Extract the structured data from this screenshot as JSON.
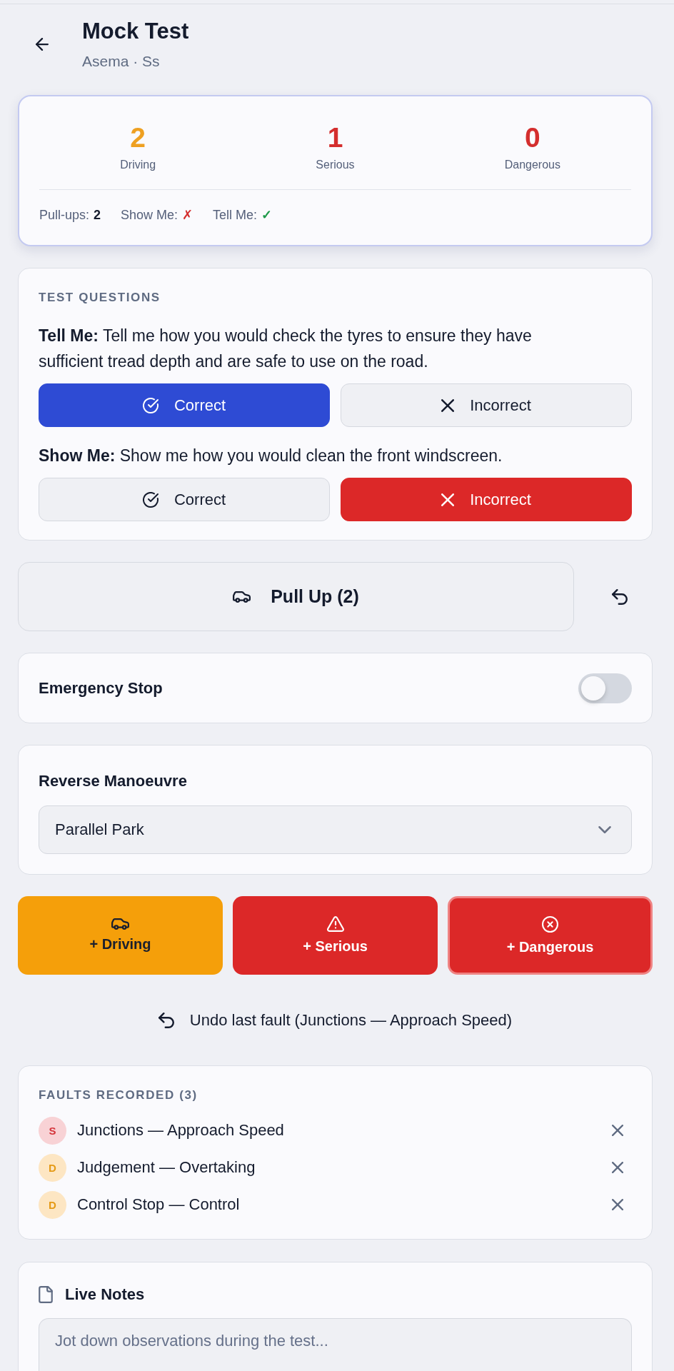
{
  "header": {
    "title": "Mock Test",
    "subtitle": "Asema · Ss"
  },
  "summary": {
    "counts": [
      {
        "kind": "driving",
        "value": "2",
        "label": "Driving"
      },
      {
        "kind": "serious",
        "value": "1",
        "label": "Serious"
      },
      {
        "kind": "dangerous",
        "value": "0",
        "label": "Dangerous"
      }
    ],
    "details": [
      {
        "kind": "count",
        "label": "Pull-ups:",
        "value": "2"
      },
      {
        "kind": "fail",
        "label": "Show Me:",
        "value": "✗"
      },
      {
        "kind": "pass",
        "label": "Tell Me:",
        "value": "✓"
      }
    ]
  },
  "test_questions": {
    "heading": "TEST QUESTIONS",
    "questions": [
      {
        "text": "**Tell Me:** Tell me how you would check the tyres to ensure they have sufficient tread depth and are safe to use on the road.",
        "options": [
          {
            "kind": "correct",
            "label": "Correct",
            "selected": true
          },
          {
            "kind": "incorrect",
            "label": "Incorrect",
            "selected": false
          }
        ]
      },
      {
        "text": "**Show Me:** Show me how you would clean the front windscreen.",
        "options": [
          {
            "kind": "correct",
            "label": "Correct",
            "selected": false
          },
          {
            "kind": "incorrect",
            "label": "Incorrect",
            "selected": true
          }
        ]
      }
    ]
  },
  "pull_up": {
    "label": "Pull Up (2)"
  },
  "emergency_stop": {
    "label": "Emergency Stop",
    "on": false
  },
  "reverse_manoeuvre": {
    "label": "Reverse Manoeuvre",
    "value": "Parallel Park"
  },
  "fault_buttons": [
    {
      "kind": "driving",
      "label": "+ Driving",
      "focused": false
    },
    {
      "kind": "serious",
      "label": "+ Serious",
      "focused": false
    },
    {
      "kind": "dangerous",
      "label": "+ Dangerous",
      "focused": true
    }
  ],
  "undo": {
    "label": "Undo last fault (Junctions — Approach Speed)"
  },
  "faults": {
    "heading": "FAULTS RECORDED (3)",
    "items": [
      {
        "kind": "serious",
        "badge": "S",
        "text": "Junctions — Approach Speed"
      },
      {
        "kind": "driving",
        "badge": "D",
        "text": "Judgement — Overtaking"
      },
      {
        "kind": "driving",
        "badge": "D",
        "text": "Control Stop — Control"
      }
    ]
  },
  "live_notes": {
    "title": "Live Notes",
    "placeholder": "Jot down observations during the test..."
  }
}
